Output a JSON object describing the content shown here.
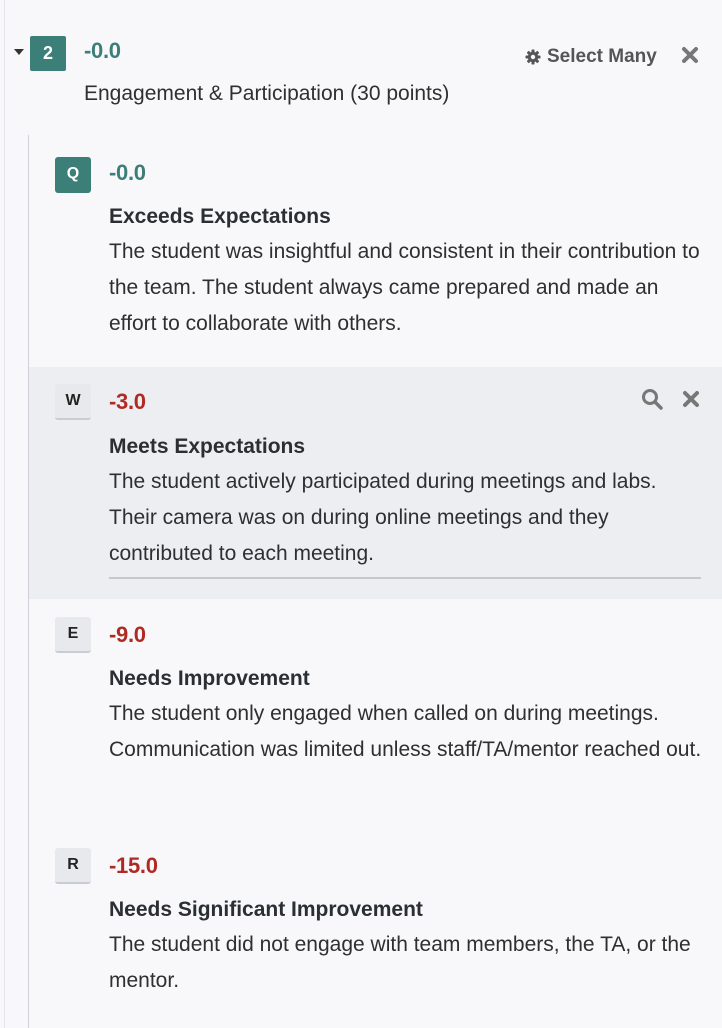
{
  "question": {
    "number": "2",
    "score": "-0.0",
    "title": "Engagement & Participation (30 points)",
    "select_many_label": "Select Many"
  },
  "items": [
    {
      "key": "Q",
      "points": "-0.0",
      "title": "Exceeds Expectations",
      "description": "The student was insightful and consistent in their contribution to the team. The student always came prepared and made an effort to collaborate with others."
    },
    {
      "key": "W",
      "points": "-3.0",
      "title": "Meets Expectations",
      "description": "The student actively participated during meetings and labs. Their camera was on during online meetings and they contributed to each meeting."
    },
    {
      "key": "E",
      "points": "-9.0",
      "title": "Needs Improvement",
      "description": "The student only engaged when called on during meetings. Communication was limited unless staff/TA/mentor reached out."
    },
    {
      "key": "R",
      "points": "-15.0",
      "title": "Needs Significant Improvement",
      "description": "The student did not engage with team members, the TA, or the mentor."
    }
  ],
  "colors": {
    "accent": "#3c7f78",
    "negative": "#b02a24",
    "highlight_bg": "#eceef2"
  },
  "icons": [
    "chevron-down-icon",
    "gear-icon",
    "close-icon",
    "search-icon"
  ]
}
